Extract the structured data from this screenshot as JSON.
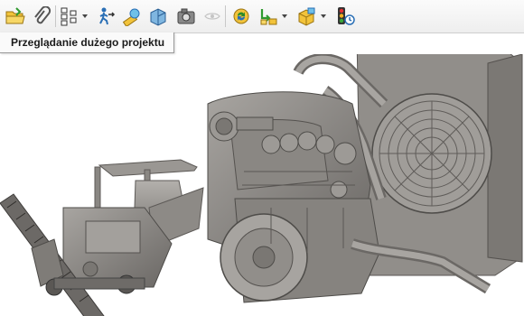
{
  "toolbar": {
    "buttons": [
      {
        "name": "open-folder-icon"
      },
      {
        "name": "paperclip-icon"
      },
      {
        "name": "tree-view-icon"
      },
      {
        "name": "walkthrough-icon"
      },
      {
        "name": "measure-icon"
      },
      {
        "name": "section-view-icon"
      },
      {
        "name": "camera-icon"
      },
      {
        "name": "eye-icon"
      },
      {
        "name": "rebuild-icon"
      },
      {
        "name": "assembly-icon"
      },
      {
        "name": "component-icon"
      },
      {
        "name": "traffic-light-icon"
      }
    ]
  },
  "tooltip": {
    "text": "Przeglądanie dużego projektu"
  },
  "colors": {
    "model": "#8f8c88",
    "model_dark": "#5e5b58",
    "model_light": "#b9b6b2"
  }
}
